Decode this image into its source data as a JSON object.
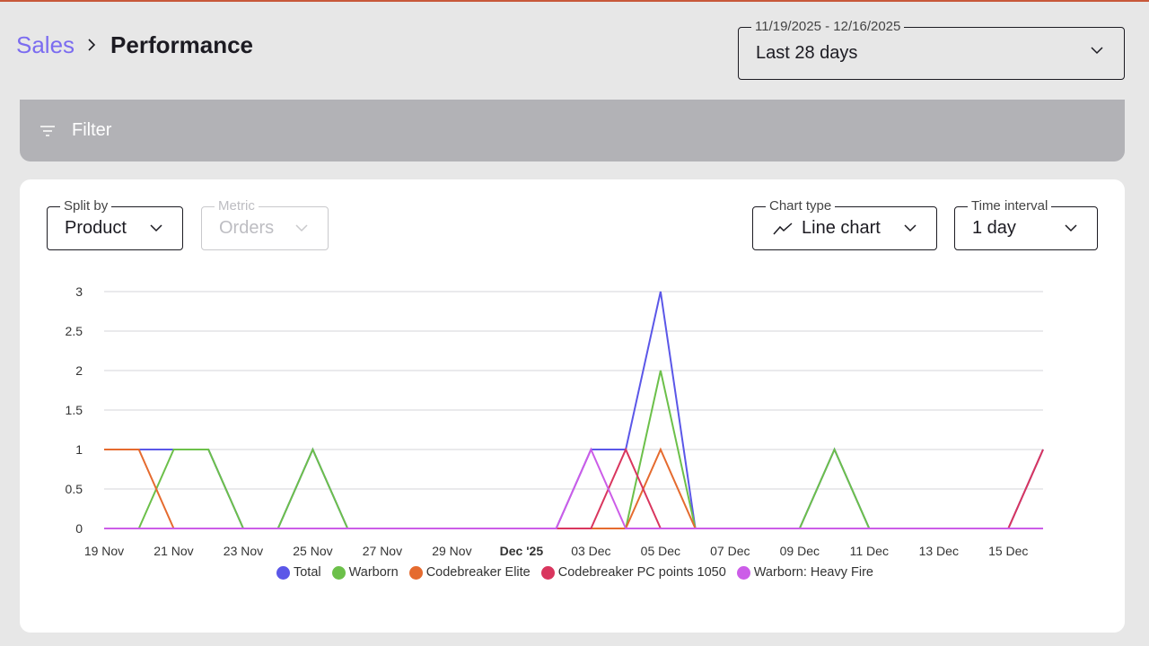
{
  "breadcrumb": {
    "parent": "Sales",
    "current": "Performance"
  },
  "date_range": {
    "legend": "11/19/2025 - 12/16/2025",
    "value": "Last 28 days"
  },
  "filter": {
    "label": "Filter"
  },
  "controls": {
    "split_by": {
      "legend": "Split by",
      "value": "Product"
    },
    "metric": {
      "legend": "Metric",
      "value": "Orders",
      "disabled": true
    },
    "chart_type": {
      "legend": "Chart type",
      "value": "Line chart"
    },
    "time_interval": {
      "legend": "Time interval",
      "value": "1 day"
    }
  },
  "icons": [
    "chevron-right-icon",
    "chevron-down-icon",
    "filter-icon",
    "line-chart-icon"
  ],
  "chart_data": {
    "type": "line",
    "x": [
      "19 Nov",
      "20 Nov",
      "21 Nov",
      "22 Nov",
      "23 Nov",
      "24 Nov",
      "25 Nov",
      "26 Nov",
      "27 Nov",
      "28 Nov",
      "29 Nov",
      "30 Nov",
      "Dec '25",
      "02 Dec",
      "03 Dec",
      "04 Dec",
      "05 Dec",
      "06 Dec",
      "07 Dec",
      "08 Dec",
      "09 Dec",
      "10 Dec",
      "11 Dec",
      "12 Dec",
      "13 Dec",
      "14 Dec",
      "15 Dec",
      "16 Dec"
    ],
    "x_tick_labels": [
      "19 Nov",
      "21 Nov",
      "23 Nov",
      "25 Nov",
      "27 Nov",
      "29 Nov",
      "Dec '25",
      "03 Dec",
      "05 Dec",
      "07 Dec",
      "09 Dec",
      "11 Dec",
      "13 Dec",
      "15 Dec"
    ],
    "y_ticks": [
      0,
      0.5,
      1,
      1.5,
      2,
      2.5,
      3
    ],
    "ylim": [
      0,
      3
    ],
    "grid": true,
    "legend_position": "bottom",
    "series": [
      {
        "name": "Total",
        "color": "#5b57e8",
        "values": [
          1,
          1,
          1,
          1,
          0,
          0,
          1,
          0,
          0,
          0,
          0,
          0,
          0,
          0,
          1,
          1,
          3,
          0,
          0,
          0,
          0,
          1,
          0,
          0,
          0,
          0,
          0,
          1
        ]
      },
      {
        "name": "Warborn",
        "color": "#6cc04a",
        "values": [
          0,
          0,
          1,
          1,
          0,
          0,
          1,
          0,
          0,
          0,
          0,
          0,
          0,
          0,
          0,
          0,
          2,
          0,
          0,
          0,
          0,
          1,
          0,
          0,
          0,
          0,
          0,
          0
        ]
      },
      {
        "name": "Codebreaker Elite",
        "color": "#e56b2f",
        "values": [
          1,
          1,
          0,
          0,
          0,
          0,
          0,
          0,
          0,
          0,
          0,
          0,
          0,
          0,
          0,
          0,
          1,
          0,
          0,
          0,
          0,
          0,
          0,
          0,
          0,
          0,
          0,
          0
        ]
      },
      {
        "name": "Codebreaker PC points 1050",
        "color": "#d9365e",
        "values": [
          0,
          0,
          0,
          0,
          0,
          0,
          0,
          0,
          0,
          0,
          0,
          0,
          0,
          0,
          0,
          1,
          0,
          0,
          0,
          0,
          0,
          0,
          0,
          0,
          0,
          0,
          0,
          1
        ]
      },
      {
        "name": "Warborn: Heavy Fire",
        "color": "#cc5de8",
        "values": [
          0,
          0,
          0,
          0,
          0,
          0,
          0,
          0,
          0,
          0,
          0,
          0,
          0,
          0,
          1,
          0,
          0,
          0,
          0,
          0,
          0,
          0,
          0,
          0,
          0,
          0,
          0,
          0
        ]
      }
    ]
  }
}
